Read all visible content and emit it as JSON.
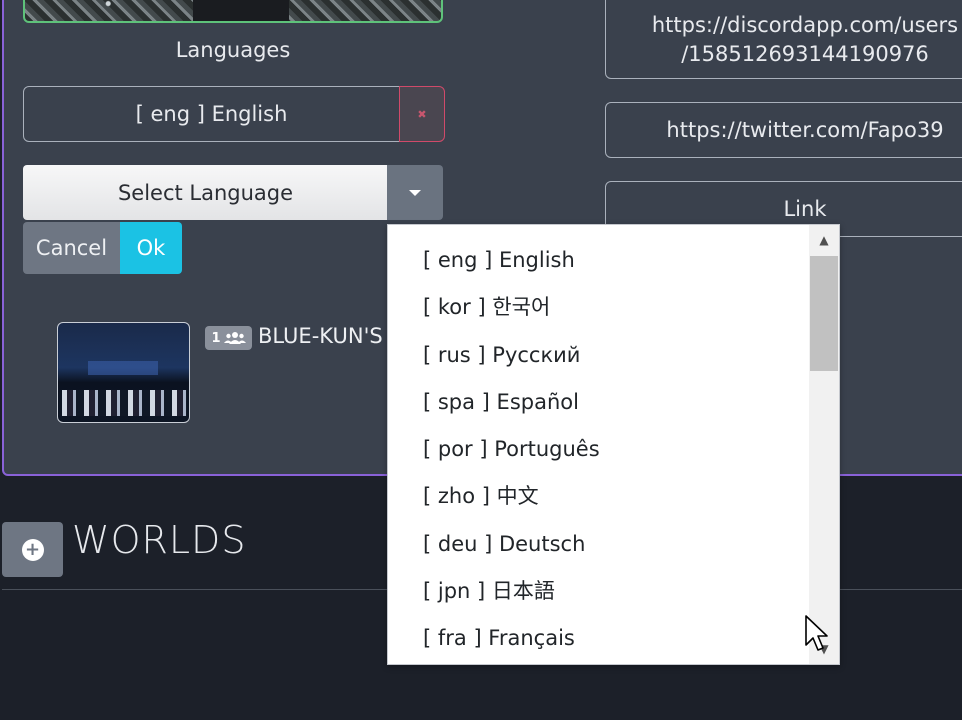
{
  "profile": {
    "languages_label": "Languages",
    "current_language": "[ eng ] English",
    "remove_icon": "close-icon",
    "select_placeholder": "Select Language",
    "cancel_label": "Cancel",
    "ok_label": "Ok"
  },
  "world": {
    "player_count": "1",
    "player_icon": "users-icon",
    "name": "BLUE-KUN'S H"
  },
  "links": {
    "discord_line1": "https://discordapp.com/users",
    "discord_line2": "/158512693144190976",
    "twitter": "https://twitter.com/Fapo39",
    "link": "Link"
  },
  "worlds_section": {
    "title": "WORLDS",
    "add_icon": "plus-circle-icon"
  },
  "language_options": [
    "[ eng ] English",
    "[ kor ] 한국어",
    "[ rus ] Русский",
    "[ spa ] Español",
    "[ por ] Português",
    "[ zho ] 中文",
    "[ deu ] Deutsch",
    "[ jpn ] 日本語",
    "[ fra ] Français"
  ],
  "colors": {
    "panel_border": "#8a62d8",
    "ok_button": "#1bc2e4",
    "remove_border": "#d04a6a",
    "background": "#1c2029"
  }
}
